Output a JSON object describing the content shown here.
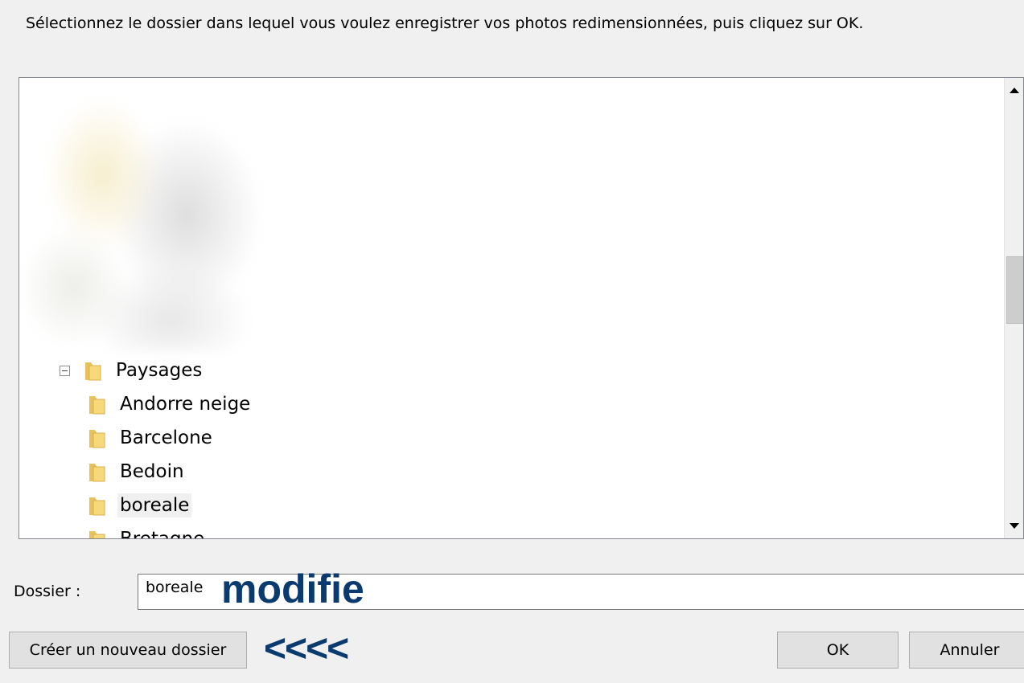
{
  "dialog": {
    "instruction": "Sélectionnez le dossier dans lequel vous voulez enregistrer vos photos redimensionnées, puis cliquez sur OK."
  },
  "tree": {
    "items": [
      {
        "label": "Paysages",
        "expanded": true,
        "level": 0
      },
      {
        "label": "Andorre neige",
        "level": 1
      },
      {
        "label": "Barcelone",
        "level": 1
      },
      {
        "label": "Bedoin",
        "level": 1
      },
      {
        "label": "boreale",
        "level": 1,
        "selected": true
      },
      {
        "label": "Bretagne",
        "level": 1,
        "partially_visible": true
      }
    ]
  },
  "folder_field": {
    "label": "Dossier :",
    "value": "boreale"
  },
  "annotations": {
    "modifie": "modifie",
    "arrows": "<<<<",
    "color": "#0b3a6f"
  },
  "buttons": {
    "new_folder": "Créer un nouveau dossier",
    "ok": "OK",
    "cancel": "Annuler"
  },
  "icons": {
    "folder": "folder-icon",
    "collapse": "collapse-minus-icon",
    "scroll_up": "scroll-up-arrow-icon",
    "scroll_down": "scroll-down-arrow-icon"
  }
}
